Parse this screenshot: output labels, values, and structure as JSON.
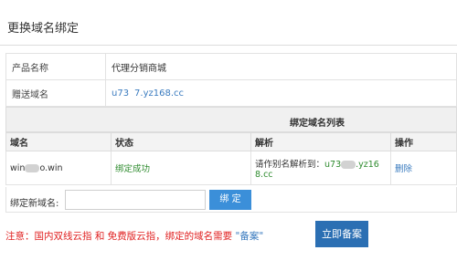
{
  "panel": {
    "title": "更换域名绑定"
  },
  "info": {
    "product_label": "产品名称",
    "product_value": "代理分销商城",
    "gift_domain_label": "赠送域名",
    "gift_domain_value": "u73   7.yz168.cc"
  },
  "bound_list": {
    "title": "绑定域名列表",
    "columns": [
      "域名",
      "状态",
      "解析",
      "操作"
    ],
    "rows": [
      {
        "domain_prefix": "win",
        "domain_suffix": "o.win",
        "status": "绑定成功",
        "resolve_prefix": "请作别名解析到：",
        "resolve_val_a": "u73",
        "resolve_val_b": ".yz16",
        "resolve_val_c": "8.cc",
        "action": "删除"
      }
    ]
  },
  "bind_new": {
    "label": "绑定新域名:",
    "input_value": "",
    "button": "绑 定"
  },
  "notice": {
    "text": "注意：国内双线云指 和 免费版云指，绑定的域名需要",
    "filing": "\"备案\""
  },
  "record_button": "立即备案",
  "colors": {
    "link": "#3a7bbf",
    "success": "#2e8b2e",
    "warning": "#e02020",
    "primary": "#3b8fd9"
  }
}
